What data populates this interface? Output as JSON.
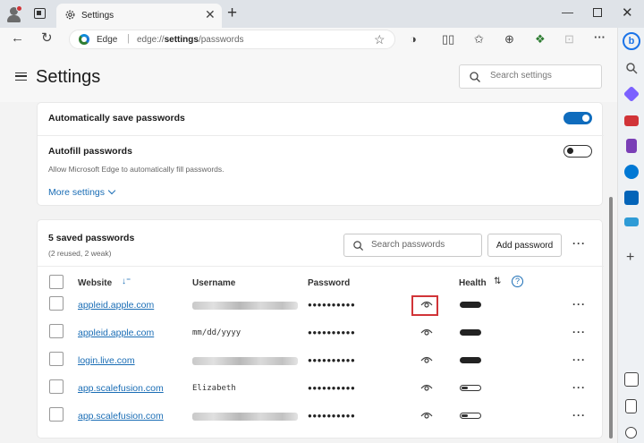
{
  "window": {
    "tab_title": "Settings",
    "tab_close": "✕",
    "new_tab": "+",
    "minimize": "—",
    "close": "✕"
  },
  "addressbar": {
    "site_label": "Edge",
    "separator": "|",
    "url_prefix": "edge://",
    "url_bold": "settings",
    "url_suffix": "/passwords"
  },
  "settings": {
    "title": "Settings",
    "search_placeholder": "Search settings"
  },
  "autosave": {
    "label": "Automatically save passwords",
    "enabled": true
  },
  "autofill": {
    "label": "Autofill passwords",
    "description": "Allow Microsoft Edge to automatically fill passwords.",
    "enabled": false
  },
  "more_settings": "More settings",
  "saved": {
    "title": "5 saved passwords",
    "subtitle": "(2 reused, 2 weak)",
    "search_placeholder": "Search passwords",
    "add_button": "Add password",
    "more": "···",
    "columns": {
      "website": "Website",
      "username": "Username",
      "password": "Password",
      "health": "Health"
    },
    "rows": [
      {
        "site": "appleid.apple.com",
        "username": "",
        "username_hidden": true,
        "password": "●●●●●●●●●●",
        "health": "strong"
      },
      {
        "site": "appleid.apple.com",
        "username": "mm/dd/yyyy",
        "username_hidden": false,
        "password": "●●●●●●●●●●",
        "health": "strong"
      },
      {
        "site": "login.live.com",
        "username": "",
        "username_hidden": true,
        "password": "●●●●●●●●●●",
        "health": "strong"
      },
      {
        "site": "app.scalefusion.com",
        "username": "Elizabeth",
        "username_hidden": false,
        "password": "●●●●●●●●●●",
        "health": "weak"
      },
      {
        "site": "app.scalefusion.com",
        "username": "",
        "username_hidden": true,
        "password": "●●●●●●●●●●",
        "health": "weak"
      }
    ]
  },
  "colors": {
    "accent": "#0f6cbd",
    "link": "#1a6db5",
    "highlight": "#d13438"
  },
  "icons": {
    "sidebar": [
      "bing-icon",
      "search-icon",
      "tag-icon",
      "toolbox-icon",
      "games-icon",
      "office-icon",
      "outlook-icon",
      "shopping-icon",
      "add-icon"
    ]
  }
}
